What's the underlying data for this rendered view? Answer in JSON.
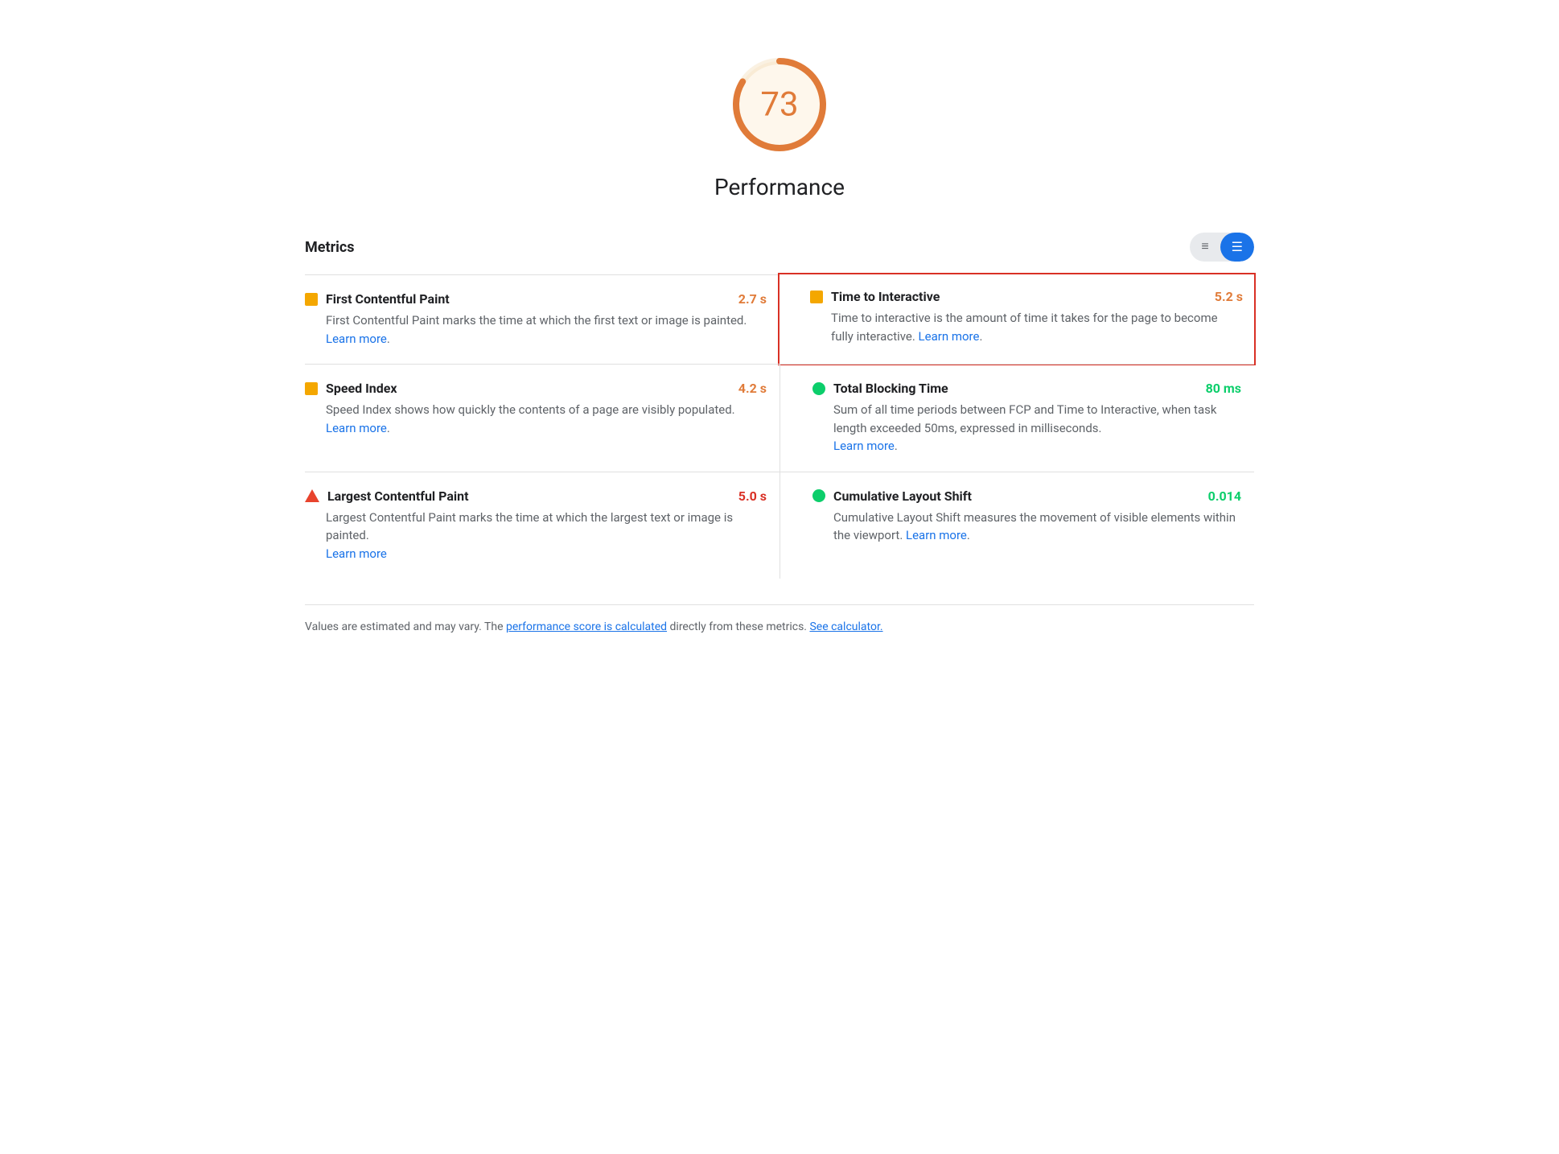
{
  "score": {
    "value": "73",
    "label": "Performance",
    "color": "#e07b39",
    "bg_color": "#fef7ec"
  },
  "metrics_title": "Metrics",
  "toggle": {
    "list_icon": "≡",
    "grid_icon": "≡"
  },
  "metrics": [
    {
      "id": "fcp",
      "name": "First Contentful Paint",
      "value": "2.7 s",
      "value_color": "orange",
      "icon": "orange-square",
      "description": "First Contentful Paint marks the time at which the first text or image is painted.",
      "learn_more_text": "Learn more",
      "learn_more_url": "#",
      "highlighted": false,
      "position": "left"
    },
    {
      "id": "tti",
      "name": "Time to Interactive",
      "value": "5.2 s",
      "value_color": "orange",
      "icon": "orange-square",
      "description": "Time to interactive is the amount of time it takes for the page to become fully interactive.",
      "learn_more_text": "Learn more",
      "learn_more_url": "#",
      "highlighted": true,
      "position": "right"
    },
    {
      "id": "si",
      "name": "Speed Index",
      "value": "4.2 s",
      "value_color": "orange",
      "icon": "orange-square",
      "description": "Speed Index shows how quickly the contents of a page are visibly populated.",
      "learn_more_text": "Learn more",
      "learn_more_url": "#",
      "highlighted": false,
      "position": "left"
    },
    {
      "id": "tbt",
      "name": "Total Blocking Time",
      "value": "80 ms",
      "value_color": "green",
      "icon": "green-circle",
      "description": "Sum of all time periods between FCP and Time to Interactive, when task length exceeded 50ms, expressed in milliseconds.",
      "learn_more_text": "Learn more",
      "learn_more_url": "#",
      "highlighted": false,
      "position": "right"
    },
    {
      "id": "lcp",
      "name": "Largest Contentful Paint",
      "value": "5.0 s",
      "value_color": "red",
      "icon": "red-triangle",
      "description": "Largest Contentful Paint marks the time at which the largest text or image is painted.",
      "learn_more_text": "Learn more",
      "learn_more_url": "#",
      "highlighted": false,
      "position": "left"
    },
    {
      "id": "cls",
      "name": "Cumulative Layout Shift",
      "value": "0.014",
      "value_color": "green",
      "icon": "green-circle",
      "description": "Cumulative Layout Shift measures the movement of visible elements within the viewport.",
      "learn_more_text": "Learn more",
      "learn_more_url": "#",
      "highlighted": false,
      "position": "right"
    }
  ],
  "footer": {
    "text_before": "Values are estimated and may vary. The ",
    "link1_text": "performance score is calculated",
    "link1_url": "#",
    "text_middle": " directly from these metrics. ",
    "link2_text": "See calculator.",
    "link2_url": "#"
  }
}
